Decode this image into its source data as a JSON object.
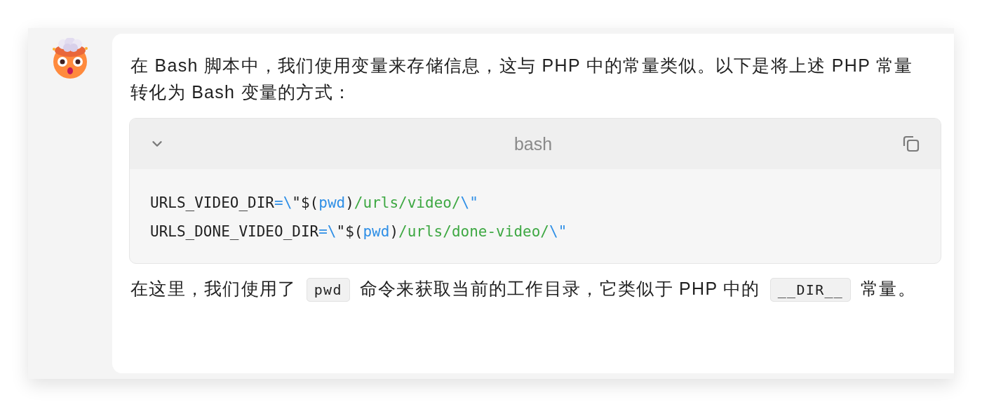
{
  "message": {
    "avatar": {
      "kind": "emoji"
    },
    "intro": "在 Bash 脚本中，我们使用变量来存储信息，这与 PHP 中的常量类似。以下是将上述 PHP 常量转化为 Bash 变量的方式：",
    "code_block": {
      "expanded": true,
      "language": "bash",
      "lines": [
        [
          {
            "kind": "plain",
            "text": "URLS_VIDEO_DIR"
          },
          {
            "kind": "keyword",
            "text": "=\\"
          },
          {
            "kind": "plain",
            "text": "\"$("
          },
          {
            "kind": "keyword",
            "text": "pwd"
          },
          {
            "kind": "plain",
            "text": ")"
          },
          {
            "kind": "string",
            "text": "/urls/video/"
          },
          {
            "kind": "keyword",
            "text": "\\\""
          }
        ],
        [
          {
            "kind": "plain",
            "text": "URLS_DONE_VIDEO_DIR"
          },
          {
            "kind": "keyword",
            "text": "=\\"
          },
          {
            "kind": "plain",
            "text": "\"$("
          },
          {
            "kind": "keyword",
            "text": "pwd"
          },
          {
            "kind": "plain",
            "text": ")"
          },
          {
            "kind": "string",
            "text": "/urls/done-video/"
          },
          {
            "kind": "keyword",
            "text": "\\\""
          }
        ]
      ]
    },
    "outro": [
      {
        "kind": "text",
        "text": "在这里，我们使用了"
      },
      {
        "kind": "code",
        "text": "pwd"
      },
      {
        "kind": "text",
        "text": "命令来获取当前的工作目录，它类似于 PHP 中的"
      },
      {
        "kind": "code",
        "text": "__DIR__"
      },
      {
        "kind": "text",
        "text": "常量。"
      }
    ]
  }
}
